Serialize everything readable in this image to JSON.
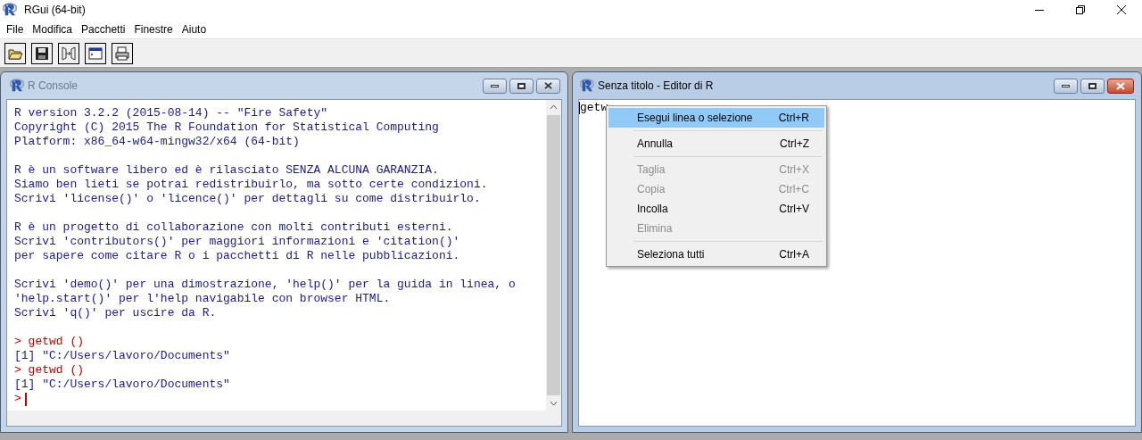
{
  "window": {
    "title": "RGui (64-bit)"
  },
  "menubar": [
    "File",
    "Modifica",
    "Pacchetti",
    "Finestre",
    "Aiuto"
  ],
  "console": {
    "title": "R Console",
    "blocks": [
      {
        "lines": [
          {
            "kind": "output",
            "text": "R version 3.2.2 (2015-08-14) -- \"Fire Safety\""
          },
          {
            "kind": "output",
            "text": "Copyright (C) 2015 The R Foundation for Statistical Computing"
          },
          {
            "kind": "output",
            "text": "Platform: x86_64-w64-mingw32/x64 (64-bit)"
          }
        ]
      },
      {
        "lines": [
          {
            "kind": "output",
            "text": "R è un software libero ed è rilasciato SENZA ALCUNA GARANZIA."
          },
          {
            "kind": "output",
            "text": "Siamo ben lieti se potrai redistribuirlo, ma sotto certe condizioni."
          },
          {
            "kind": "output",
            "text": "Scrivi 'license()' o 'licence()' per dettagli su come distribuirlo."
          }
        ]
      },
      {
        "lines": [
          {
            "kind": "output",
            "text": "R è un progetto di collaborazione con molti contributi esterni."
          },
          {
            "kind": "output",
            "text": "Scrivi 'contributors()' per maggiori informazioni e 'citation()'"
          },
          {
            "kind": "output",
            "text": "per sapere come citare R o i pacchetti di R nelle pubblicazioni."
          }
        ]
      },
      {
        "lines": [
          {
            "kind": "output",
            "text": "Scrivi 'demo()' per una dimostrazione, 'help()' per la guida in linea, o"
          },
          {
            "kind": "output",
            "text": "'help.start()' per l'help navigabile con browser HTML."
          },
          {
            "kind": "output",
            "text": "Scrivi 'q()' per uscire da R."
          }
        ]
      },
      {
        "lines": [
          {
            "kind": "command",
            "text": "> getwd ()"
          },
          {
            "kind": "output",
            "text": "[1] \"C:/Users/lavoro/Documents\""
          },
          {
            "kind": "command",
            "text": "> getwd ()"
          },
          {
            "kind": "output",
            "text": "[1] \"C:/Users/lavoro/Documents\""
          },
          {
            "kind": "prompt",
            "text": ">"
          }
        ]
      }
    ]
  },
  "editor": {
    "title": "Senza titolo - Editor di R",
    "text": "getw"
  },
  "context_menu": [
    {
      "kind": "item",
      "label": "Esegui linea o selezione",
      "shortcut": "Ctrl+R",
      "selected": true,
      "disabled": false
    },
    {
      "kind": "separator"
    },
    {
      "kind": "item",
      "label": "Annulla",
      "shortcut": "Ctrl+Z",
      "selected": false,
      "disabled": false
    },
    {
      "kind": "separator"
    },
    {
      "kind": "item",
      "label": "Taglia",
      "shortcut": "Ctrl+X",
      "selected": false,
      "disabled": true
    },
    {
      "kind": "item",
      "label": "Copia",
      "shortcut": "Ctrl+C",
      "selected": false,
      "disabled": true
    },
    {
      "kind": "item",
      "label": "Incolla",
      "shortcut": "Ctrl+V",
      "selected": false,
      "disabled": false
    },
    {
      "kind": "item",
      "label": "Elimina",
      "selected": false,
      "disabled": true
    },
    {
      "kind": "separator"
    },
    {
      "kind": "item",
      "label": "Seleziona tutti",
      "shortcut": "Ctrl+A",
      "selected": false,
      "disabled": false
    }
  ]
}
